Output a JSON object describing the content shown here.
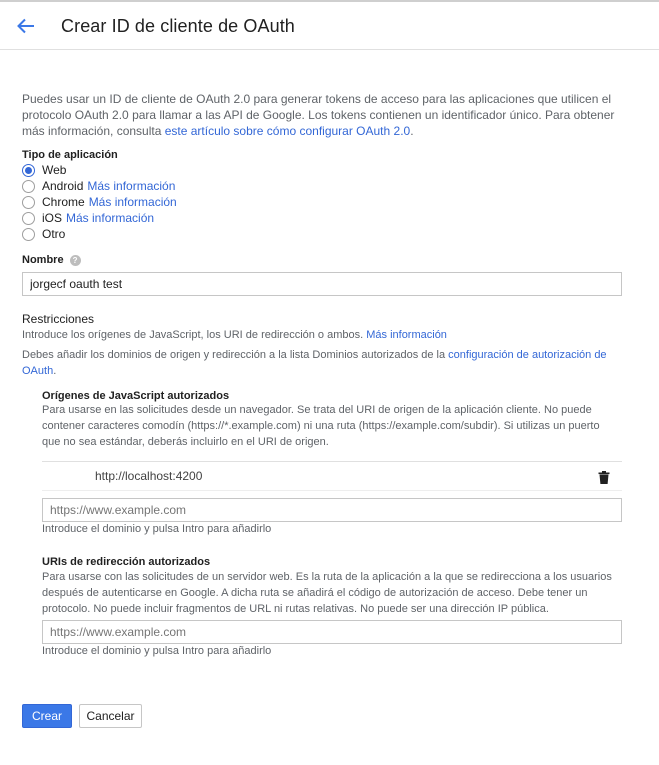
{
  "header": {
    "title": "Crear ID de cliente de OAuth",
    "back_icon": "arrow-back-icon"
  },
  "intro": {
    "line1": "Puedes usar un ID de cliente de OAuth 2.0 para generar tokens de acceso para las aplicaciones que utilicen el",
    "line2": "protocolo OAuth 2.0 para llamar a las API de Google. Los tokens contienen un identificador único. Para obtener",
    "line3_prefix": "más información, consulta ",
    "line3_link": "este artículo sobre cómo configurar OAuth 2.0",
    "line3_suffix": "."
  },
  "app_type": {
    "label": "Tipo de aplicación",
    "options": [
      {
        "label": "Web",
        "link": "",
        "checked": true
      },
      {
        "label": "Android",
        "link": "Más información",
        "checked": false
      },
      {
        "label": "Chrome",
        "link": "Más información",
        "checked": false
      },
      {
        "label": "iOS",
        "link": "Más información",
        "checked": false
      },
      {
        "label": "Otro",
        "link": "",
        "checked": false
      }
    ]
  },
  "name": {
    "label": "Nombre",
    "value": "jorgecf oauth test"
  },
  "restrictions": {
    "title": "Restricciones",
    "desc_prefix": "Introduce los orígenes de JavaScript, los URI de redirección o ambos. ",
    "desc_link": "Más información",
    "domains_prefix": "Debes añadir los dominios de origen y redirección a la lista Dominios autorizados de la ",
    "domains_link_1": "configuración de autorización de",
    "domains_link_2": "OAuth",
    "domains_suffix": "."
  },
  "js_origins": {
    "title": "Orígenes de JavaScript autorizados",
    "desc1": "Para usarse en las solicitudes desde un navegador. Se trata del URI de origen de la aplicación cliente. No puede",
    "desc2": "contener caracteres comodín (https://*.example.com) ni una ruta (https://example.com/subdir). Si utilizas un puerto",
    "desc3": "que no sea estándar, deberás incluirlo en el URI de origen.",
    "entries": [
      "http://localhost:4200"
    ],
    "placeholder": "https://www.example.com",
    "hint": "Introduce el dominio y pulsa Intro para añadirlo"
  },
  "redirect_uris": {
    "title": "URIs de redirección autorizados",
    "desc1": "Para usarse con las solicitudes de un servidor web. Es la ruta de la aplicación a la que se redirecciona a los usuarios",
    "desc2": "después de autenticarse en Google. A dicha ruta se añadirá el código de autorización de acceso. Debe tener un",
    "desc3": "protocolo. No puede incluir fragmentos de URL ni rutas relativas. No puede ser una dirección IP pública.",
    "placeholder": "https://www.example.com",
    "hint": "Introduce el dominio y pulsa Intro para añadirlo"
  },
  "actions": {
    "create": "Crear",
    "cancel": "Cancelar"
  }
}
